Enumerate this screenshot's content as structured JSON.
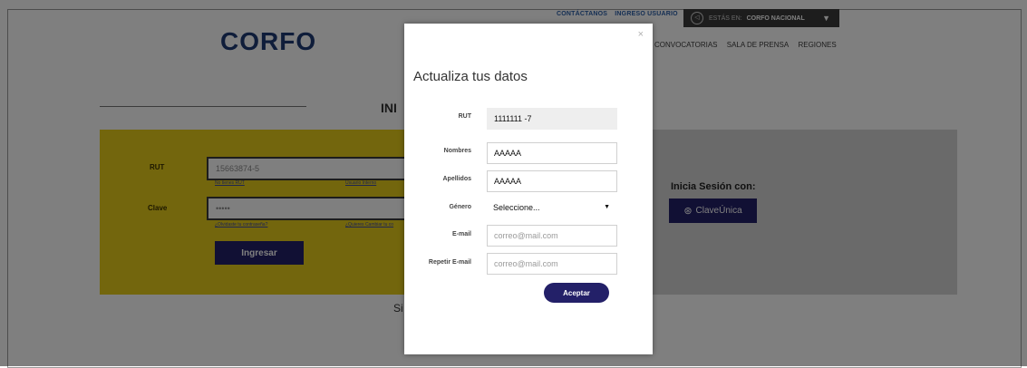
{
  "header": {
    "links": [
      "CONTÁCTANOS",
      "INGRESO USUARIO"
    ],
    "region_prefix": "ESTÁS EN:",
    "region_name": "CORFO NACIONAL",
    "logo": "CORFO",
    "nav": [
      "CONVOCATORIAS",
      "SALA DE PRENSA",
      "REGIONES"
    ]
  },
  "login": {
    "section_title": "INI",
    "rut_label": "RUT",
    "rut_value": "15663874-5",
    "no_rut_link": "No tienes RUT",
    "internal_user_link": "Usuario Interno",
    "clave_label": "Clave",
    "clave_value": "•••••",
    "forgot_link": "¿Olvidaste tu contraseña?",
    "change_link": "¿Quieres Cambiar tu co",
    "submit": "Ingresar",
    "alt_title": "Inicia Sesión con:",
    "clave_unica_button": "ClaveÚnica",
    "bottom_text": "Si"
  },
  "modal": {
    "close": "×",
    "title": "Actualiza tus datos",
    "fields": {
      "rut_label": "RUT",
      "rut_value": "1111111 -7",
      "nombres_label": "Nombres",
      "nombres_value": "AAAAA",
      "apellidos_label": "Apellidos",
      "apellidos_value": "AAAAA",
      "genero_label": "Género",
      "genero_value": "Seleccione...",
      "email_label": "E-mail",
      "email_placeholder": "correo@mail.com",
      "repeat_email_label": "Repetir E-mail",
      "repeat_email_placeholder": "correo@mail.com"
    },
    "submit": "Aceptar"
  },
  "colors": {
    "brand_navy": "#232068",
    "login_yellow": "#e7cd1a",
    "panel_gray": "#d5d5d5",
    "overlay": "rgba(0,0,0,0.5)"
  }
}
